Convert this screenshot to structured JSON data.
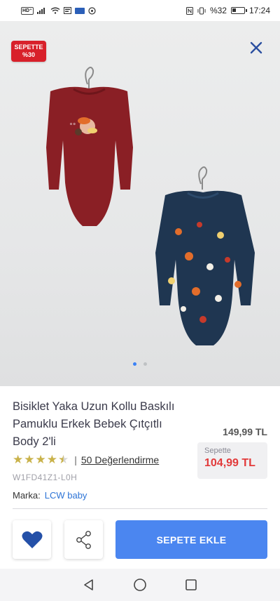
{
  "status_bar": {
    "hd_label": "HD⁺",
    "battery_text": "%32",
    "battery_level": 0.32,
    "time": "17:24"
  },
  "gallery": {
    "promo_badge": {
      "line1": "SEPETTE",
      "line2": "%30",
      "color": "#d8202a"
    },
    "close_icon": "close-icon",
    "image_count": 2,
    "active_index": 0
  },
  "product": {
    "title": "Bisiklet Yaka Uzun Kollu Baskılı Pamuklu Erkek Bebek Çıtçıtlı Body 2'li",
    "rating": 4.5,
    "rating_separator": "|",
    "reviews_label": "50 Değerlendirme",
    "sku": "W1FD41Z1-L0H",
    "old_price": "149,99 TL",
    "cart_price_label": "Sepette",
    "cart_price": "104,99 TL",
    "brand_label": "Marka:",
    "brand_name": "LCW baby"
  },
  "actions": {
    "favorite_icon": "heart-icon",
    "share_icon": "share-icon",
    "add_to_cart_label": "SEPETE EKLE"
  },
  "colors": {
    "accent_blue": "#4b86f0",
    "price_red": "#e23a3a",
    "brand_link": "#2d74d6",
    "star": "#c9b24a",
    "heart": "#2450a8"
  },
  "navbar": {
    "back_icon": "back-triangle-icon",
    "home_icon": "home-circle-icon",
    "recents_icon": "recents-square-icon"
  }
}
